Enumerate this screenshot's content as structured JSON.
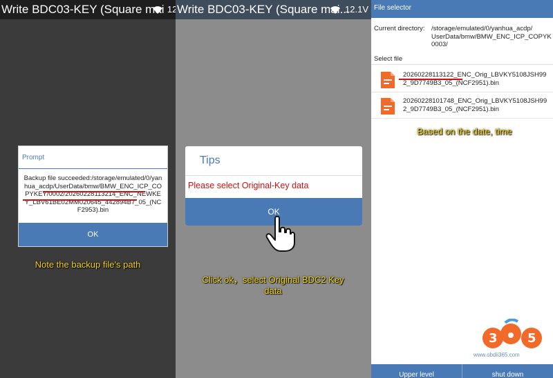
{
  "panel1": {
    "status_title": "Write BDC03-KEY (Square mai",
    "status_right": "12.",
    "dialog": {
      "title": "Prompt",
      "message": "Backup file succeeded:/storage/emulated/0/yanhua_acdp/UserData/bmw/BMW_ENC_ICP_COPYKEY/0002/20260228113214_ENC_NEWKEY_LBV61BE02MM020645_442894B7_05_(NCF2953).bin",
      "ok": "OK"
    },
    "caption": "Note the backup file's path"
  },
  "panel2": {
    "status_title": "Write BDC03-KEY (Square mai...",
    "status_right": "12.1V",
    "dialog": {
      "title": "Tips",
      "message": "Please select Original-Key data",
      "ok": "OK"
    },
    "caption": "Click ok，select Original BDC2 Key data"
  },
  "panel3": {
    "header": "File selector",
    "current_dir_label": "Current directory:",
    "current_dir_lines": [
      "/storage/emulated/0/yanhua_acdp/",
      "UserData/bmw/BMW_ENC_ICP_COPYK",
      "0003/"
    ],
    "select_label": "Select file",
    "files": [
      {
        "line1": "20260228113122_ENC_Orig_LBVKY5108JSH99",
        "line2": "2_9D7749B3_05_(NCF2951).bin"
      },
      {
        "line1": "20260228101748_ENC_Orig_LBVKY5108JSH99",
        "line2": "2_9D7749B3_05_(NCF2951).bin"
      }
    ],
    "caption": "Based on the date, time",
    "bottom_buttons": [
      "Upper level",
      "shut down"
    ],
    "watermark_url": "www.obdii365.com",
    "logo_text": "365"
  },
  "colors": {
    "accent": "#4a7ab5",
    "alert_red": "#d01010",
    "caption_yellow": "#f5d312",
    "file_icon": "#f26a2a"
  }
}
